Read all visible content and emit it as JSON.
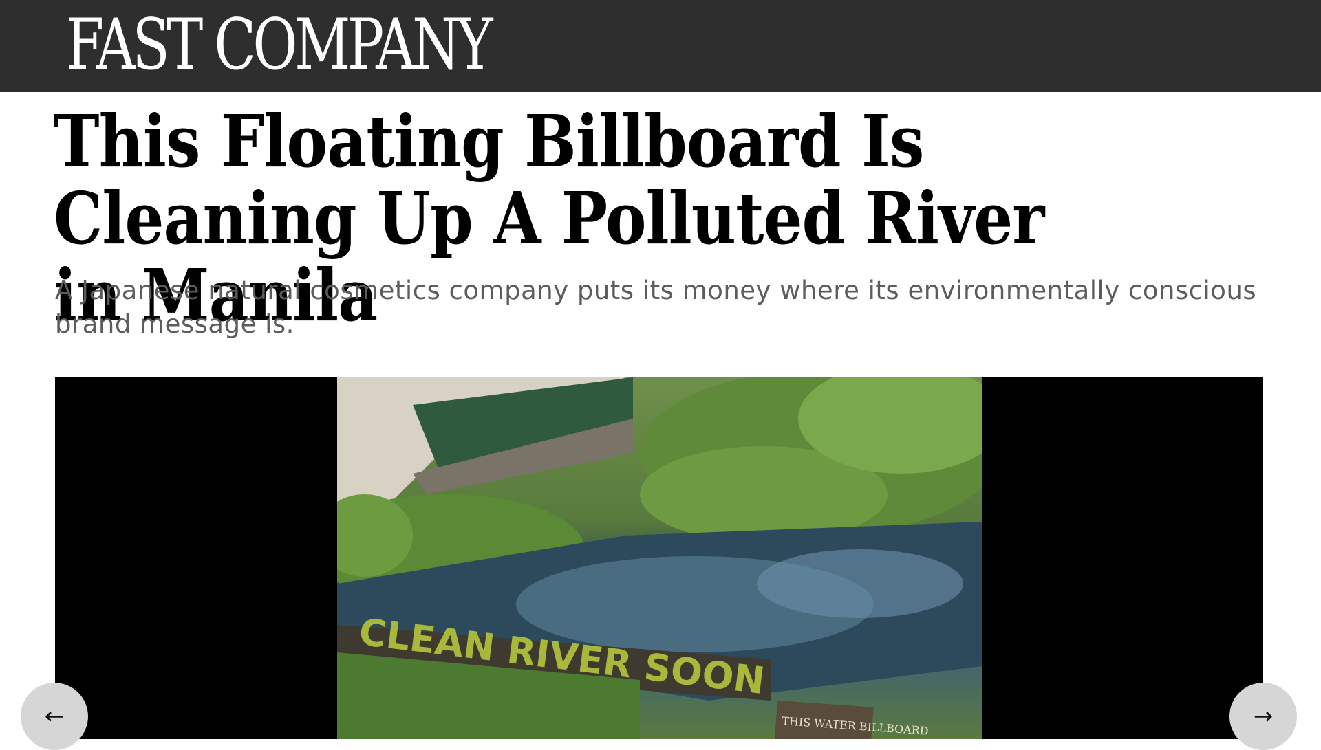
{
  "header": {
    "logo_text": "FAST COMPANY",
    "background_color": "#2e2e2e",
    "logo_color": "#ffffff"
  },
  "article": {
    "headline": "This Floating Billboard Is Cleaning Up A Polluted River in Manila",
    "dek": "A Japanese natural cosmetics company puts its money where its environmentally conscious brand message is."
  },
  "gallery": {
    "image_sign_text": "CLEAN RIVER SOON",
    "image_small_sign_text": "THIS WATER BILLBOARD",
    "prev_icon": "arrow-left-icon",
    "next_icon": "arrow-right-icon",
    "prev_glyph": "←",
    "next_glyph": "→"
  }
}
